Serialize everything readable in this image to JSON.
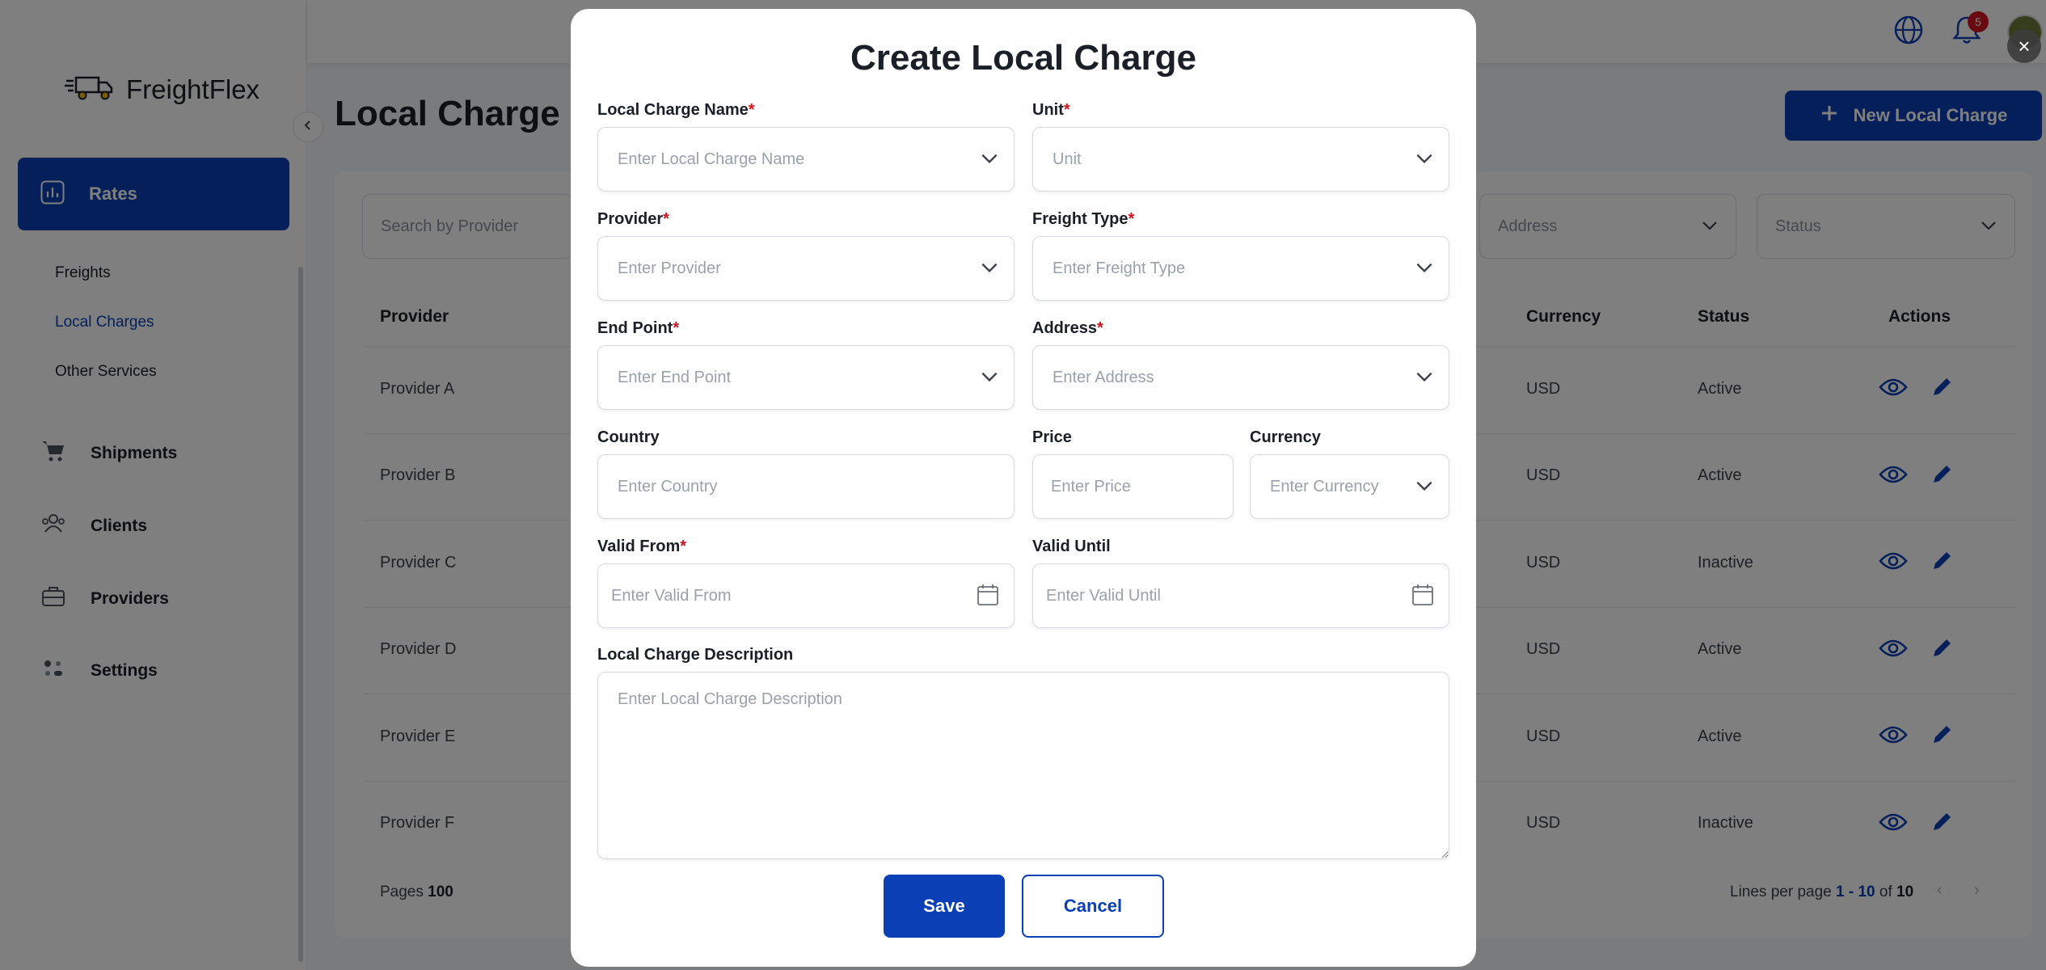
{
  "app": {
    "name": "FreightFlex"
  },
  "sidebar": {
    "active": {
      "label": "Rates",
      "icon": "chart-icon"
    },
    "subitems": [
      {
        "label": "Freights"
      },
      {
        "label": "Local Charges",
        "active": true
      },
      {
        "label": "Other Services"
      }
    ],
    "items": [
      {
        "label": "Shipments",
        "icon": "cart-icon"
      },
      {
        "label": "Clients",
        "icon": "users-icon"
      },
      {
        "label": "Providers",
        "icon": "briefcase-icon"
      },
      {
        "label": "Settings",
        "icon": "settings-icon"
      }
    ]
  },
  "topbar": {
    "notification_count": "5"
  },
  "page": {
    "title": "Local Charge M",
    "new_button_label": "New Local Charge"
  },
  "filters": {
    "search_placeholder": "Search by Provider",
    "address_placeholder": "Address",
    "status_placeholder": "Status"
  },
  "table": {
    "columns": [
      "Provider",
      "Currency",
      "Status",
      "Actions"
    ],
    "rows": [
      {
        "provider": "Provider A",
        "currency": "USD",
        "status": "Active"
      },
      {
        "provider": "Provider B",
        "currency": "USD",
        "status": "Active"
      },
      {
        "provider": "Provider C",
        "currency": "USD",
        "status": "Inactive"
      },
      {
        "provider": "Provider D",
        "currency": "USD",
        "status": "Active"
      },
      {
        "provider": "Provider E",
        "currency": "USD",
        "status": "Active"
      },
      {
        "provider": "Provider F",
        "currency": "USD",
        "status": "Inactive"
      }
    ]
  },
  "footer": {
    "pages_label": "Pages",
    "pages_value": "100",
    "lines_per_page_label": "Lines per page",
    "range": "1 - 10",
    "of_label": "of",
    "total": "10"
  },
  "modal": {
    "title": "Create Local Charge",
    "close_label": "×",
    "fields": {
      "name": {
        "label": "Local Charge Name",
        "placeholder": "Enter Local Charge Name"
      },
      "unit": {
        "label": "Unit",
        "placeholder": "Unit"
      },
      "provider": {
        "label": "Provider",
        "placeholder": "Enter Provider"
      },
      "freight_type": {
        "label": "Freight Type",
        "placeholder": "Enter Freight Type"
      },
      "end_point": {
        "label": "End Point",
        "placeholder": "Enter End Point"
      },
      "address": {
        "label": "Address",
        "placeholder": "Enter Address"
      },
      "country": {
        "label": "Country",
        "placeholder": "Enter Country"
      },
      "price": {
        "label": "Price",
        "placeholder": "Enter Price"
      },
      "currency": {
        "label": "Currency",
        "placeholder": "Enter Currency"
      },
      "valid_from": {
        "label": "Valid From",
        "placeholder": "Enter Valid From"
      },
      "valid_until": {
        "label": "Valid Until",
        "placeholder": "Enter Valid Until"
      },
      "description": {
        "label": "Local Charge Description",
        "placeholder": "Enter Local Charge Description"
      }
    },
    "required_mark": "*",
    "save_label": "Save",
    "cancel_label": "Cancel"
  },
  "colors": {
    "primary": "#0a3fb5",
    "danger": "#d0141e"
  }
}
